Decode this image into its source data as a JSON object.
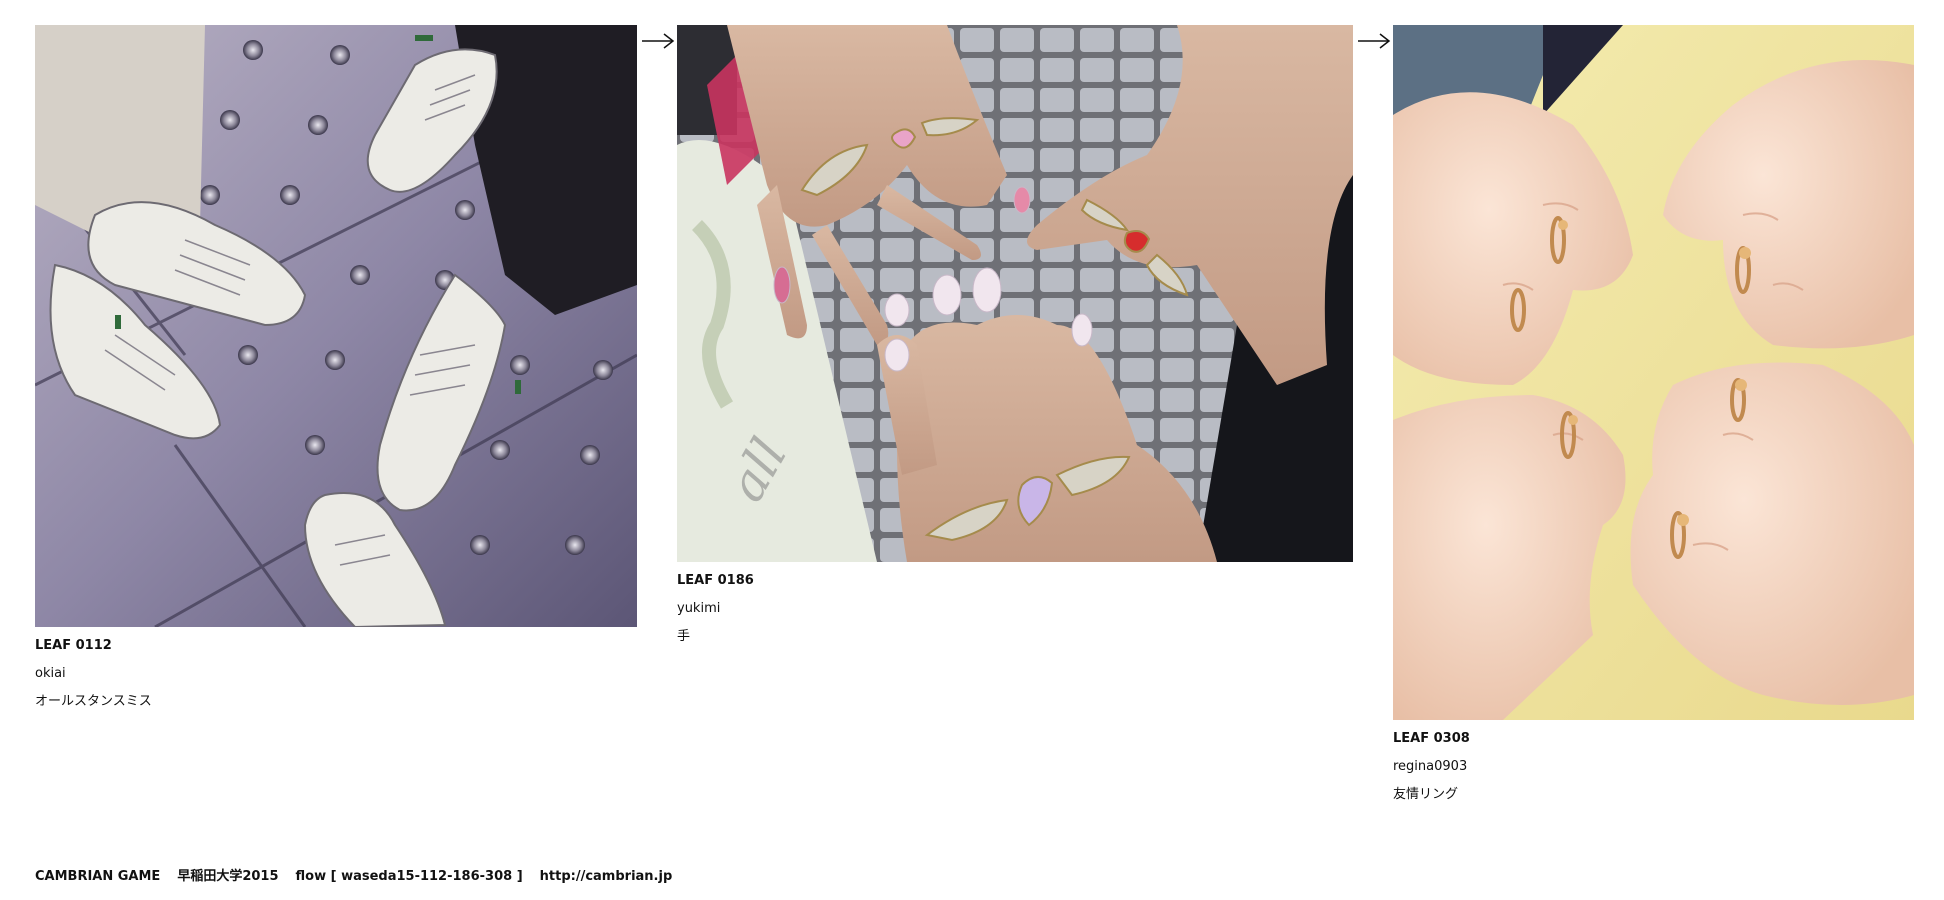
{
  "leaves": [
    {
      "id": "LEAF 0112",
      "user": "okiai",
      "caption": "オールスタンスミス",
      "image": "photo of five pairs of white sneakers on a studded pavement"
    },
    {
      "id": "LEAF 0186",
      "user": "yukimi",
      "caption": "手",
      "image": "photo of three hands wearing jeweled angel-wing rings"
    },
    {
      "id": "LEAF 0308",
      "user": "regina0903",
      "caption": "友情リング",
      "image": "photo of four hands touching knuckles wearing gold friendship rings"
    }
  ],
  "footer": {
    "project": "CAMBRIAN GAME",
    "event": "早稲田大学2015",
    "flow": "flow [ waseda15-112-186-308 ]",
    "url": "http://cambrian.jp"
  },
  "colors": {
    "text": "#111111",
    "background": "#ffffff"
  },
  "icons": {
    "arrow": "right-arrow-icon"
  }
}
